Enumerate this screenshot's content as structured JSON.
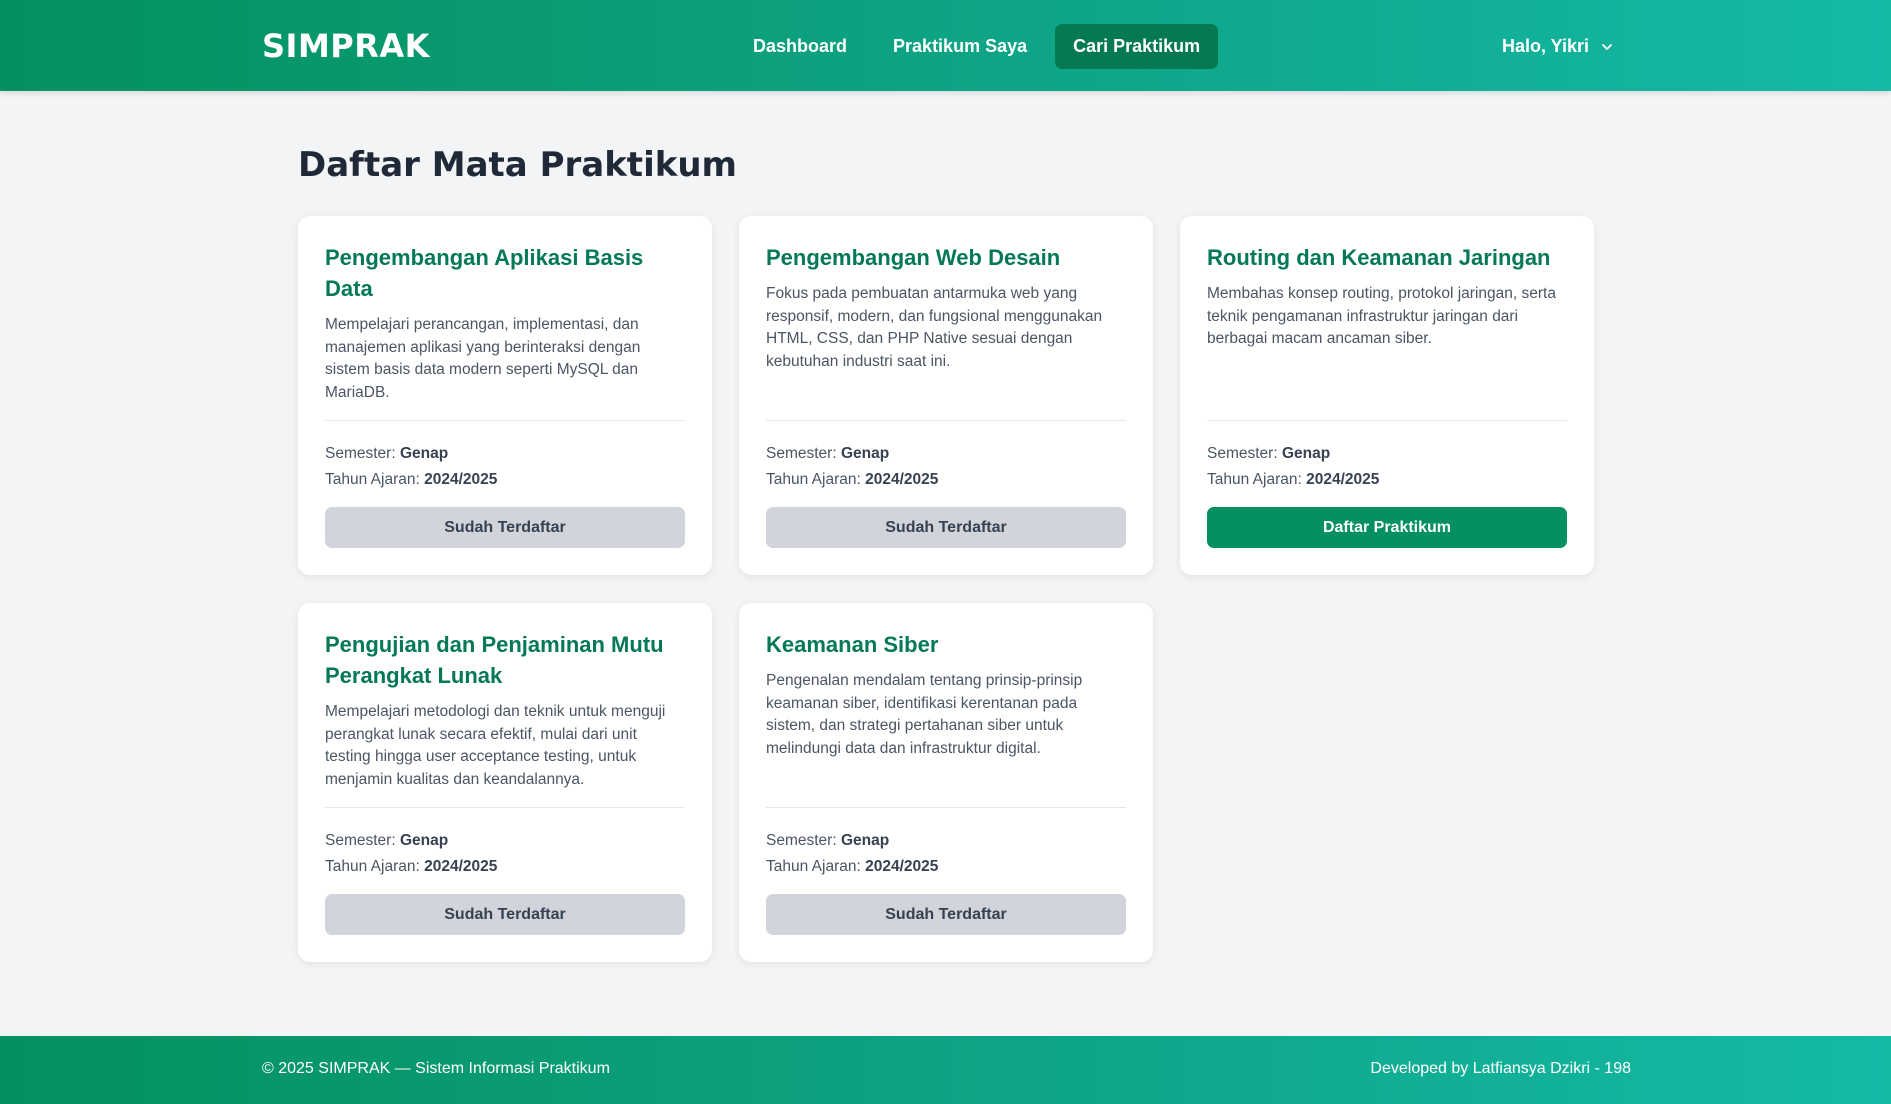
{
  "header": {
    "brand": "SIMPRAK",
    "nav": [
      {
        "label": "Dashboard",
        "active": false
      },
      {
        "label": "Praktikum Saya",
        "active": false
      },
      {
        "label": "Cari Praktikum",
        "active": true
      }
    ],
    "user_greeting": "Halo, Yikri",
    "user_icon": "chevron-down-icon"
  },
  "main": {
    "title": "Daftar Mata Praktikum",
    "semester_label": "Semester:",
    "year_label": "Tahun Ajaran:",
    "courses": [
      {
        "title": "Pengembangan Aplikasi Basis Data",
        "description": "Mempelajari perancangan, implementasi, dan manajemen aplikasi yang berinteraksi dengan sistem basis data modern seperti MySQL dan MariaDB.",
        "semester": "Genap",
        "year": "2024/2025",
        "button_label": "Sudah Terdaftar",
        "registered": true
      },
      {
        "title": "Pengembangan Web Desain",
        "description": "Fokus pada pembuatan antarmuka web yang responsif, modern, dan fungsional menggunakan HTML, CSS, dan PHP Native sesuai dengan kebutuhan industri saat ini.",
        "semester": "Genap",
        "year": "2024/2025",
        "button_label": "Sudah Terdaftar",
        "registered": true
      },
      {
        "title": "Routing dan Keamanan Jaringan",
        "description": "Membahas konsep routing, protokol jaringan, serta teknik pengamanan infrastruktur jaringan dari berbagai macam ancaman siber.",
        "semester": "Genap",
        "year": "2024/2025",
        "button_label": "Daftar Praktikum",
        "registered": false
      },
      {
        "title": "Pengujian dan Penjaminan Mutu Perangkat Lunak",
        "description": "Mempelajari metodologi dan teknik untuk menguji perangkat lunak secara efektif, mulai dari unit testing hingga user acceptance testing, untuk menjamin kualitas dan keandalannya.",
        "semester": "Genap",
        "year": "2024/2025",
        "button_label": "Sudah Terdaftar",
        "registered": true
      },
      {
        "title": "Keamanan Siber",
        "description": "Pengenalan mendalam tentang prinsip-prinsip keamanan siber, identifikasi kerentanan pada sistem, dan strategi pertahanan siber untuk melindungi data dan infrastruktur digital.",
        "semester": "Genap",
        "year": "2024/2025",
        "button_label": "Sudah Terdaftar",
        "registered": true
      }
    ]
  },
  "footer": {
    "copyright": "© 2025 SIMPRAK — Sistem Informasi Praktikum",
    "credit": "Developed by Latfiansya Dzikri - 198"
  },
  "colors": {
    "primary": "#05905f",
    "primary_dark": "#057a52",
    "accent_teal": "#15b9a6",
    "title_green": "#047857",
    "disabled_button": "#d1d5db",
    "background": "#f3f4f6"
  }
}
